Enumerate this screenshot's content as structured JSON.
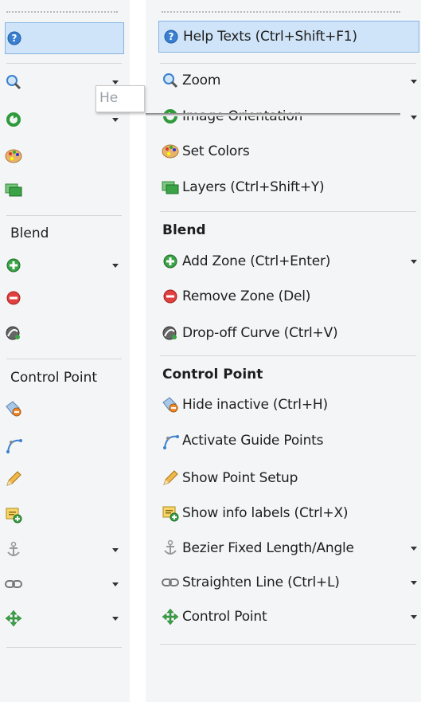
{
  "narrow": {
    "sections": {
      "blend": "Blend",
      "control_point": "Control Point"
    },
    "icons": [
      "help-icon",
      "zoom-icon",
      "rotate-icon",
      "palette-icon",
      "layers-icon",
      "add-zone-icon",
      "remove-zone-icon",
      "dropoff-curve-icon",
      "hide-inactive-icon",
      "guide-points-icon",
      "pencil-icon",
      "info-labels-icon",
      "anchor-icon",
      "chain-link-icon",
      "control-point-icon"
    ]
  },
  "tooltip": {
    "text": "He"
  },
  "wide": {
    "items": {
      "help": "Help Texts (Ctrl+Shift+F1)",
      "zoom": "Zoom",
      "orientation": "Image Orientation",
      "colors": "Set Colors",
      "layers": "Layers (Ctrl+Shift+Y)",
      "add_zone": "Add Zone (Ctrl+Enter)",
      "remove_zone": "Remove Zone (Del)",
      "dropoff": "Drop-off Curve (Ctrl+V)",
      "hide_inactive": "Hide inactive (Ctrl+H)",
      "guide_points": "Activate Guide Points",
      "point_setup": "Show Point Setup",
      "info_labels": "Show info labels (Ctrl+X)",
      "bezier": "Bezier Fixed Length/Angle",
      "straighten": "Straighten Line (Ctrl+L)",
      "control_point": "Control Point"
    },
    "sections": {
      "blend": "Blend",
      "control_point": "Control Point"
    }
  },
  "colors": {
    "selected_bg": "#cfe4f8",
    "selected_border": "#84b4e3",
    "panel_bg": "#f4f5f6"
  }
}
